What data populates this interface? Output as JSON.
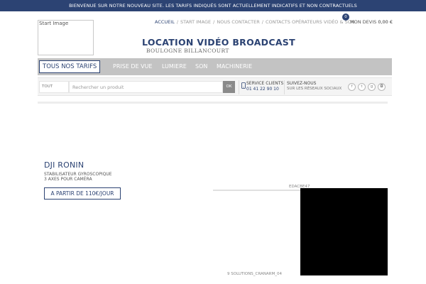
{
  "announcement": "BIENVENUE SUR NOTRE NOUVEAU SITE. LES TARIFS INDIQUÉS SONT ACTUELLEMENT INDICATIFS ET NON CONTRACTUELS",
  "logo_alt": "Start Image",
  "breadcrumb": [
    "ACCUEIL",
    "START IMAGE",
    "NOUS CONTACTER",
    "CONTACTS OPÉRATEURS VIDÉO & SON"
  ],
  "cart": {
    "count": "0",
    "label": "MON DEVIS",
    "amount": "0,00 €"
  },
  "site": {
    "title": "LOCATION VIDÉO BROADCAST",
    "subtitle": "BOULOGNE BILLANCOURT"
  },
  "nav": [
    "TOUS NOS TARIFS",
    "PRISE DE VUE",
    "LUMIERE",
    "SON",
    "MACHINERIE"
  ],
  "search": {
    "category": "TOUT",
    "placeholder": "Rechercher un produit",
    "button": "OK"
  },
  "service": {
    "label": "SERVICE CLIENTS",
    "phone": "01 41 22 90 10"
  },
  "follow": {
    "label": "SUIVEZ-NOUS",
    "sub": "SUR LES RÉSEAUX SOCIAUX"
  },
  "socials": [
    "facebook-icon",
    "twitter-icon",
    "google-plus-icon",
    "instagram-icon"
  ],
  "slide": {
    "title": "DJI RONIN",
    "desc_line1": "STABILISATEUR GYROSCOPIQUE",
    "desc_line2": "3 AXES POUR CAMÉRA",
    "button": "A PARTIR DE 110€/JOUR"
  },
  "fragments": {
    "top": "EDACBE47",
    "bottom": "9 SOLUTIONS_CRANARM_04"
  },
  "colors": {
    "brand": "#2c4373",
    "nav_bg": "#c3c3c3",
    "video_bg": "#000000"
  }
}
